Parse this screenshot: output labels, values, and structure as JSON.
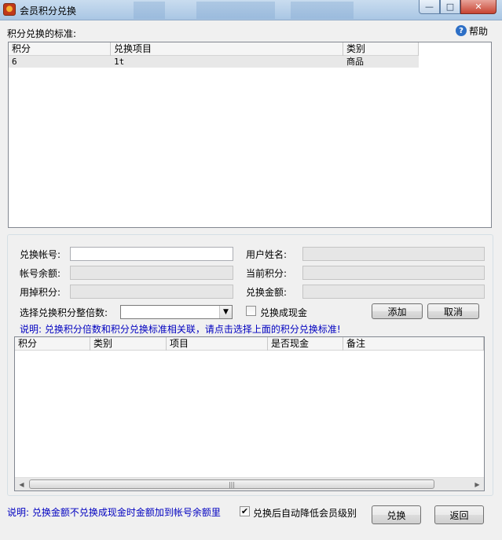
{
  "window": {
    "title": "会员积分兑换",
    "minimize_glyph": "—",
    "maximize_glyph": "□",
    "close_glyph": "✕"
  },
  "help": {
    "label": "帮助",
    "icon": "question-icon",
    "glyph": "?"
  },
  "standards": {
    "heading": "积分兑换的标准:",
    "columns": [
      "积分",
      "兑换项目",
      "类别"
    ],
    "rows": [
      {
        "points": "6",
        "item": "1t",
        "category": "商品"
      }
    ]
  },
  "form": {
    "account_label": "兑换帐号:",
    "account_value": "",
    "username_label": "用户姓名:",
    "username_value": "",
    "balance_label": "帐号余额:",
    "balance_value": "",
    "current_points_label": "当前积分:",
    "current_points_value": "",
    "used_points_label": "用掉积分:",
    "used_points_value": "",
    "amount_label": "兑换金额:",
    "amount_value": "",
    "multiple_label": "选择兑换积分整倍数:",
    "multiple_value": "",
    "cash_label": "兑换成现金",
    "cash_checked": false,
    "add_label": "添加",
    "cancel_label": "取消",
    "note": "说明: 兑换积分倍数和积分兑换标准相关联，请点击选择上面的积分兑换标准!"
  },
  "exchange_list": {
    "columns": [
      "积分",
      "类别",
      "项目",
      "是否现金",
      "备注"
    ],
    "rows": [],
    "scroll_left": "◀",
    "scroll_right": "▶",
    "thumb_grip": "|||"
  },
  "footer": {
    "note": "说明: 兑换金额不兑换成现金时金额加到帐号余额里",
    "auto_downgrade_label": "兑换后自动降低会员级别",
    "auto_downgrade_checked": true,
    "check_glyph": "✔",
    "exchange_label": "兑换",
    "back_label": "返回"
  },
  "colors": {
    "note_text": "#0000c0",
    "title_bar": "#a9c6e4"
  }
}
